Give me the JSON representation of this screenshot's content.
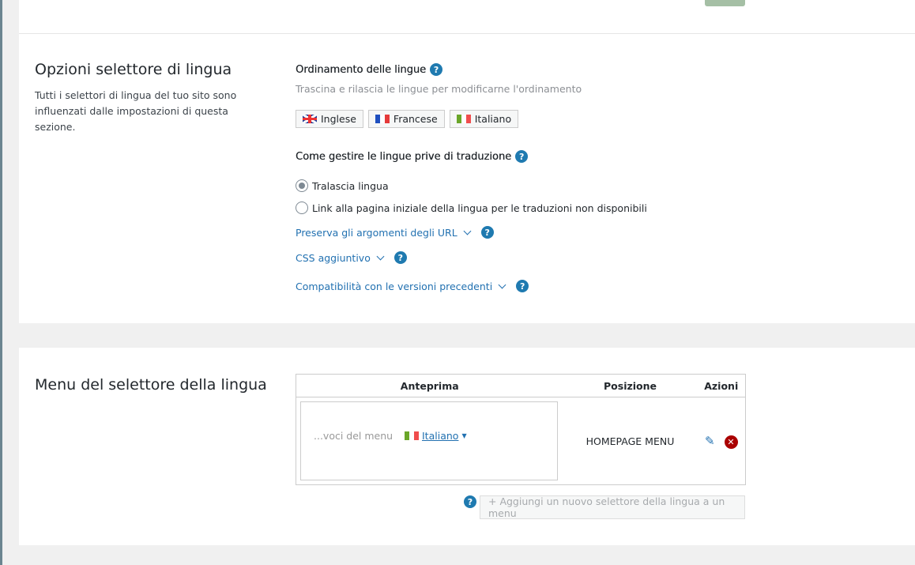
{
  "options_section": {
    "title": "Opzioni selettore di lingua",
    "description": "Tutti i selettori di lingua del tuo sito sono influenzati dalle impostazioni di questa sezione.",
    "order_label": "Ordinamento delle lingue",
    "order_hint": "Trascina e rilascia le lingue per modificarne l'ordinamento",
    "languages": [
      "Inglese",
      "Francese",
      "Italiano"
    ],
    "missing_label": "Come gestire le lingue prive di traduzione",
    "radio_options": [
      {
        "label": "Tralascia lingua",
        "checked": true
      },
      {
        "label": "Link alla pagina iniziale della lingua per le traduzioni non disponibili",
        "checked": false
      }
    ],
    "expanders": [
      "Preserva gli argomenti degli URL",
      "CSS aggiuntivo",
      "Compatibilità con le versioni precedenti"
    ],
    "help": "?"
  },
  "menu_section": {
    "title": "Menu del selettore della lingua",
    "columns": [
      "Anteprima",
      "Posizione",
      "Azioni"
    ],
    "row": {
      "menu_items": "...voci del menu",
      "current_language": "Italiano",
      "position": "HOMEPAGE MENU"
    },
    "add_button": "+ Aggiungi un nuovo selettore della lingua a un menu"
  }
}
